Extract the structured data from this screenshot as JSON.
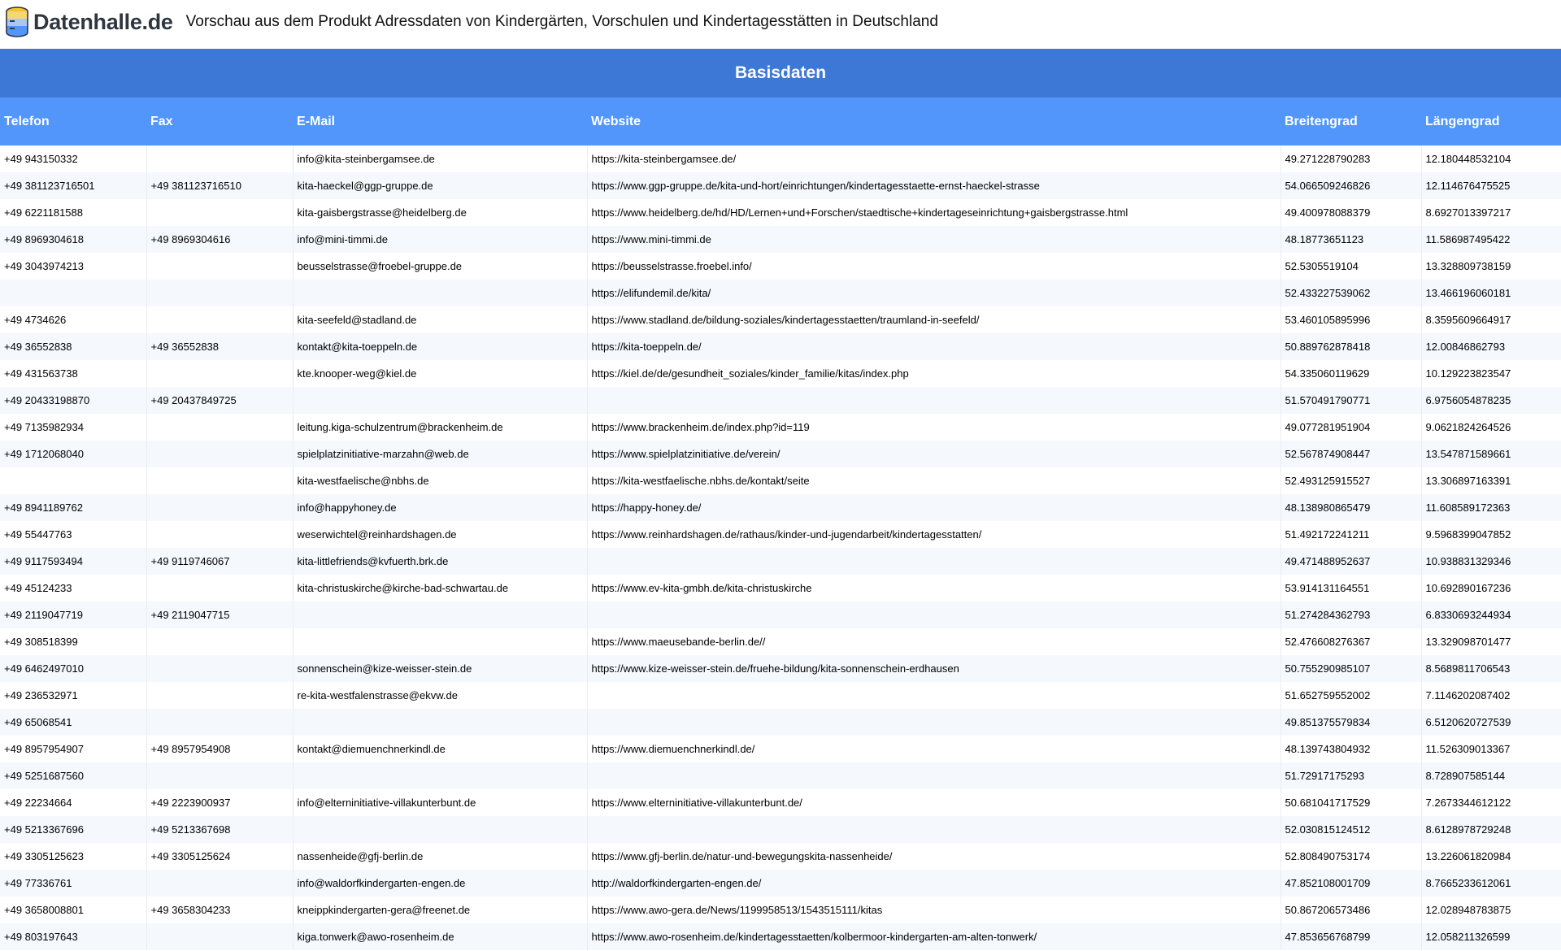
{
  "header": {
    "logo_text": "Datenhalle.de",
    "title": "Vorschau aus dem Produkt Adressdaten von Kindergärten, Vorschulen und Kindertagesstätten in Deutschland"
  },
  "table": {
    "group_label": "Basisdaten",
    "columns": [
      "Telefon",
      "Fax",
      "E-Mail",
      "Website",
      "Breitengrad",
      "Längengrad"
    ],
    "rows": [
      [
        "+49 943150332",
        "",
        "info@kita-steinbergamsee.de",
        "https://kita-steinbergamsee.de/",
        "49.271228790283",
        "12.180448532104"
      ],
      [
        "+49 381123716501",
        "+49 381123716510",
        "kita-haeckel@ggp-gruppe.de",
        "https://www.ggp-gruppe.de/kita-und-hort/einrichtungen/kindertagesstaette-ernst-haeckel-strasse",
        "54.066509246826",
        "12.114676475525"
      ],
      [
        "+49 6221181588",
        "",
        "kita-gaisbergstrasse@heidelberg.de",
        "https://www.heidelberg.de/hd/HD/Lernen+und+Forschen/staedtische+kindertageseinrichtung+gaisbergstrasse.html",
        "49.400978088379",
        "8.6927013397217"
      ],
      [
        "+49 8969304618",
        "+49 8969304616",
        "info@mini-timmi.de",
        "https://www.mini-timmi.de",
        "48.18773651123",
        "11.586987495422"
      ],
      [
        "+49 3043974213",
        "",
        "beusselstrasse@froebel-gruppe.de",
        "https://beusselstrasse.froebel.info/",
        "52.5305519104",
        "13.328809738159"
      ],
      [
        "",
        "",
        "",
        "https://elifundemil.de/kita/",
        "52.433227539062",
        "13.466196060181"
      ],
      [
        "+49 4734626",
        "",
        "kita-seefeld@stadland.de",
        "https://www.stadland.de/bildung-soziales/kindertagesstaetten/traumland-in-seefeld/",
        "53.460105895996",
        "8.3595609664917"
      ],
      [
        "+49 36552838",
        "+49 36552838",
        "kontakt@kita-toeppeln.de",
        "https://kita-toeppeln.de/",
        "50.889762878418",
        "12.00846862793"
      ],
      [
        "+49 431563738",
        "",
        "kte.knooper-weg@kiel.de",
        "https://kiel.de/de/gesundheit_soziales/kinder_familie/kitas/index.php",
        "54.335060119629",
        "10.129223823547"
      ],
      [
        "+49 20433198870",
        "+49 20437849725",
        "",
        "",
        "51.570491790771",
        "6.9756054878235"
      ],
      [
        "+49 7135982934",
        "",
        "leitung.kiga-schulzentrum@brackenheim.de",
        "https://www.brackenheim.de/index.php?id=119",
        "49.077281951904",
        "9.0621824264526"
      ],
      [
        "+49 1712068040",
        "",
        "spielplatzinitiative-marzahn@web.de",
        "https://www.spielplatzinitiative.de/verein/",
        "52.567874908447",
        "13.547871589661"
      ],
      [
        "",
        "",
        "kita-westfaelische@nbhs.de",
        "https://kita-westfaelische.nbhs.de/kontakt/seite",
        "52.493125915527",
        "13.306897163391"
      ],
      [
        "+49 8941189762",
        "",
        "info@happyhoney.de",
        "https://happy-honey.de/",
        "48.138980865479",
        "11.608589172363"
      ],
      [
        "+49 55447763",
        "",
        "weserwichtel@reinhardshagen.de",
        "https://www.reinhardshagen.de/rathaus/kinder-und-jugendarbeit/kindertagesstatten/",
        "51.492172241211",
        "9.5968399047852"
      ],
      [
        "+49 9117593494",
        "+49 9119746067",
        "kita-littlefriends@kvfuerth.brk.de",
        "",
        "49.471488952637",
        "10.938831329346"
      ],
      [
        "+49 45124233",
        "",
        "kita-christuskirche@kirche-bad-schwartau.de",
        "https://www.ev-kita-gmbh.de/kita-christuskirche",
        "53.914131164551",
        "10.692890167236"
      ],
      [
        "+49 2119047719",
        "+49 2119047715",
        "",
        "",
        "51.274284362793",
        "6.8330693244934"
      ],
      [
        "+49 308518399",
        "",
        "",
        "https://www.maeusebande-berlin.de//",
        "52.476608276367",
        "13.329098701477"
      ],
      [
        "+49 6462497010",
        "",
        "sonnenschein@kize-weisser-stein.de",
        "https://www.kize-weisser-stein.de/fruehe-bildung/kita-sonnenschein-erdhausen",
        "50.755290985107",
        "8.5689811706543"
      ],
      [
        "+49 236532971",
        "",
        "re-kita-westfalenstrasse@ekvw.de",
        "",
        "51.652759552002",
        "7.1146202087402"
      ],
      [
        "+49 65068541",
        "",
        "",
        "",
        "49.851375579834",
        "6.5120620727539"
      ],
      [
        "+49 8957954907",
        "+49 8957954908",
        "kontakt@diemuenchnerkindl.de",
        "https://www.diemuenchnerkindl.de/",
        "48.139743804932",
        "11.526309013367"
      ],
      [
        "+49 5251687560",
        "",
        "",
        "",
        "51.72917175293",
        "8.728907585144"
      ],
      [
        "+49 22234664",
        "+49 2223900937",
        "info@elterninitiative-villakunterbunt.de",
        "https://www.elterninitiative-villakunterbunt.de/",
        "50.681041717529",
        "7.2673344612122"
      ],
      [
        "+49 5213367696",
        "+49 5213367698",
        "",
        "",
        "52.030815124512",
        "8.6128978729248"
      ],
      [
        "+49 3305125623",
        "+49 3305125624",
        "nassenheide@gfj-berlin.de",
        "https://www.gfj-berlin.de/natur-und-bewegungskita-nassenheide/",
        "52.808490753174",
        "13.226061820984"
      ],
      [
        "+49 77336761",
        "",
        "info@waldorfkindergarten-engen.de",
        "http://waldorfkindergarten-engen.de/",
        "47.852108001709",
        "8.7665233612061"
      ],
      [
        "+49 3658008801",
        "+49 3658304233",
        "kneippkindergarten-gera@freenet.de",
        "https://www.awo-gera.de/News/1199958513/1543515111/kitas",
        "50.867206573486",
        "12.028948783875"
      ],
      [
        "+49 803197643",
        "",
        "kiga.tonwerk@awo-rosenheim.de",
        "https://www.awo-rosenheim.de/kindertagesstaetten/kolbermoor-kindergarten-am-alten-tonwerk/",
        "47.853656768799",
        "12.058211326599"
      ]
    ]
  }
}
